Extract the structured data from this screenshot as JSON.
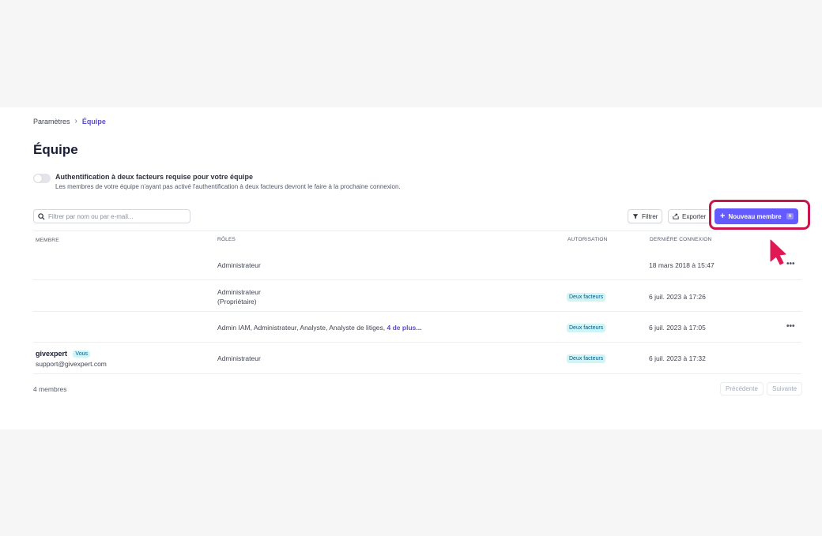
{
  "breadcrumb": {
    "parent": "Paramètres",
    "current": "Équipe"
  },
  "page_title": "Équipe",
  "twofa": {
    "title": "Authentification à deux facteurs requise pour votre équipe",
    "description": "Les membres de votre équipe n'ayant pas activé l'authentification à deux facteurs devront le faire à la prochaine connexion.",
    "enabled": false
  },
  "search": {
    "placeholder": "Filtrer par nom ou par e-mail..."
  },
  "toolbar": {
    "filter_label": "Filtrer",
    "export_label": "Exporter",
    "new_member_label": "Nouveau membre",
    "new_member_shortcut": "n"
  },
  "table": {
    "headers": {
      "member": "MEMBRE",
      "roles": "RÔLES",
      "auth": "AUTORISATION",
      "last": "DERNIÈRE CONNEXION"
    },
    "rows": [
      {
        "name": "",
        "email": "",
        "roles": "Administrateur",
        "roles2": "",
        "auth": "",
        "last": "18 mars 2018 à 15:47"
      },
      {
        "name": "",
        "email": "",
        "roles": "Administrateur",
        "roles2": "(Propriétaire)",
        "auth": "Deux facteurs",
        "last": "6 juil. 2023 à 17:26"
      },
      {
        "name": "",
        "email": "",
        "roles": "Admin IAM, Administrateur, Analyste, Analyste de litiges,",
        "roles_more": "4 de plus...",
        "auth": "Deux facteurs",
        "last": "6 juil. 2023 à 17:05"
      },
      {
        "name": "givexpert",
        "you": "Vous",
        "email": "support@givexpert.com",
        "roles": "Administrateur",
        "auth": "Deux facteurs",
        "last": "6 juil. 2023 à 17:32"
      }
    ],
    "more_icon": "•••"
  },
  "footer": {
    "count": "4 membres",
    "prev": "Précédente",
    "next": "Suivante"
  },
  "colors": {
    "accent": "#635bff",
    "highlight": "#c8174c",
    "badge_bg": "#cff5f6"
  }
}
